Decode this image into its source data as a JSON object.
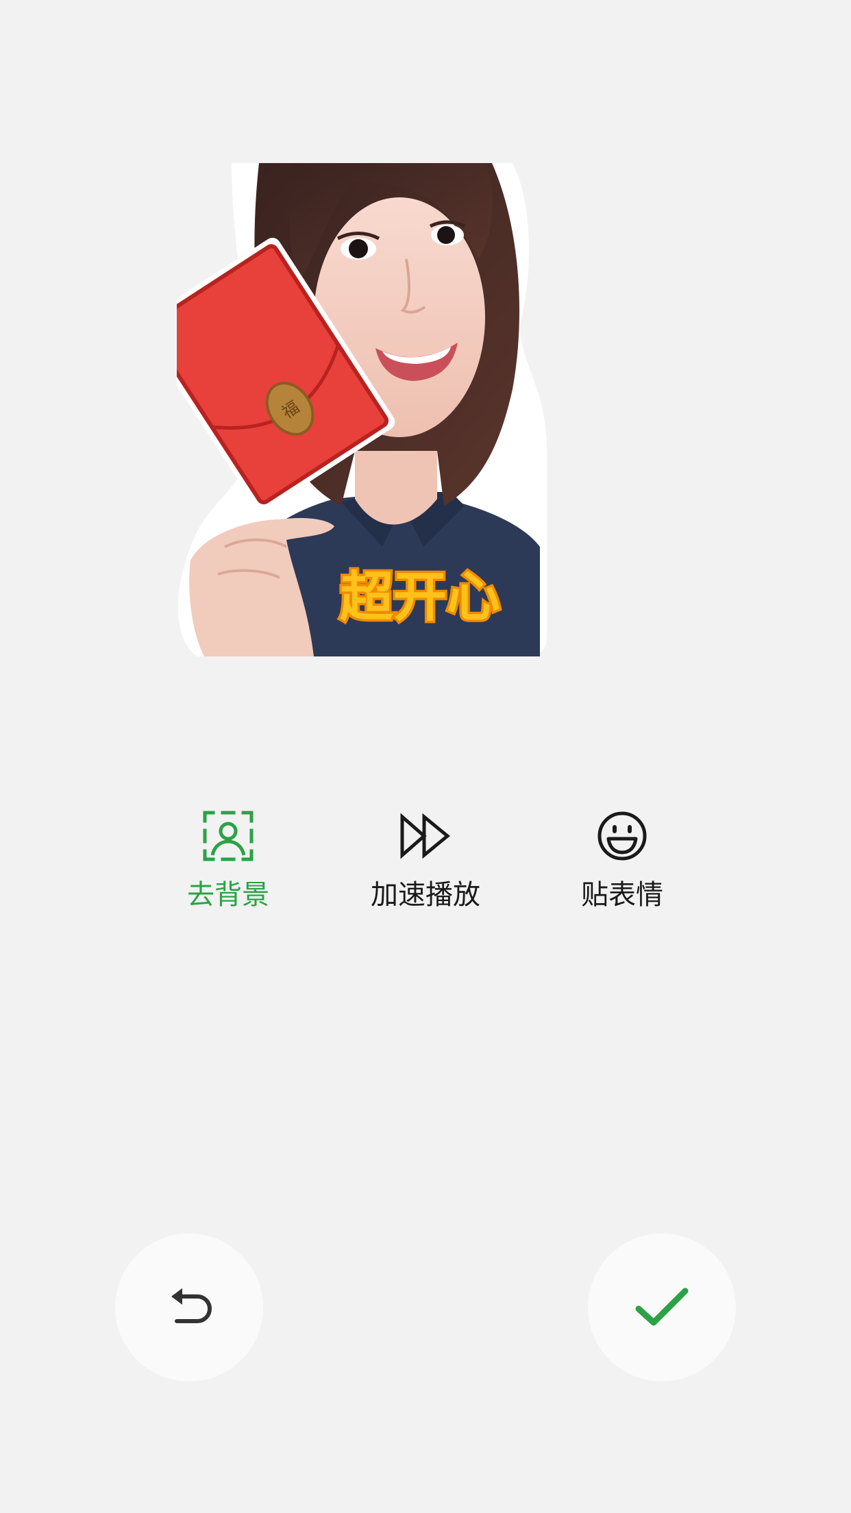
{
  "sticker": {
    "caption": "超开心",
    "envelope_coin_text": "福",
    "colors": {
      "envelope": "#e8403b",
      "caption_fill": "#ffc21a",
      "caption_stroke": "#f08a00",
      "shirt": "#2d3a57"
    }
  },
  "tools": [
    {
      "label": "去背景",
      "icon": "person-frame-icon",
      "active": true
    },
    {
      "label": "加速播放",
      "icon": "fast-forward-icon",
      "active": false
    },
    {
      "label": "贴表情",
      "icon": "smiley-icon",
      "active": false
    }
  ],
  "actions": {
    "undo_icon": "undo-icon",
    "confirm_icon": "check-icon"
  },
  "colors": {
    "background": "#f2f2f2",
    "accent_green": "#2ba245",
    "text": "#1a1a1a"
  }
}
